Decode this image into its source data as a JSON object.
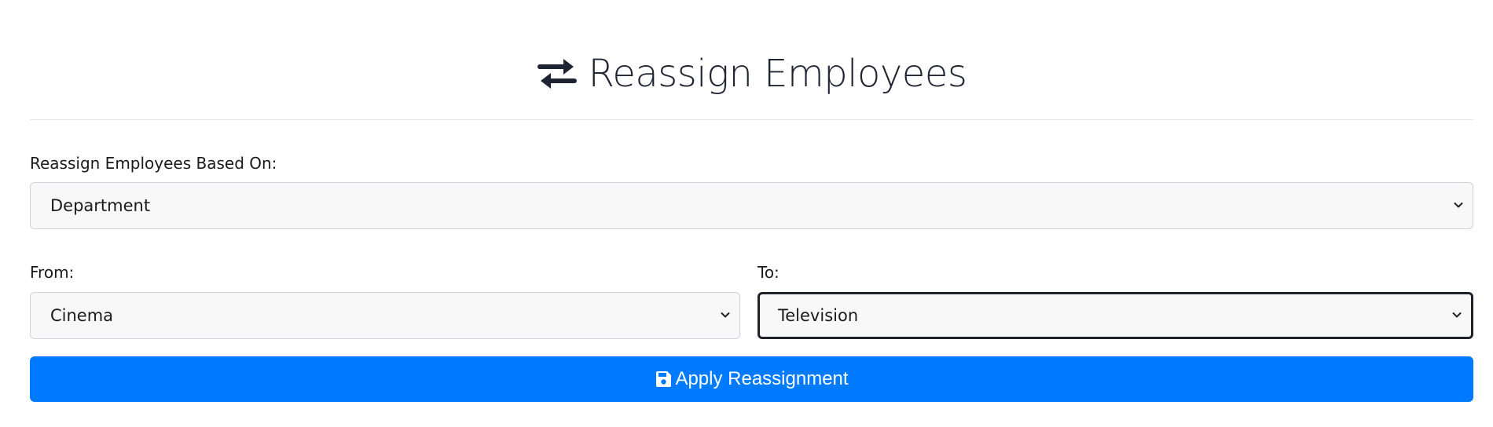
{
  "header": {
    "title": "Reassign Employees",
    "icon": "exchange-arrows-icon"
  },
  "basis": {
    "label": "Reassign Employees Based On:",
    "selected": "Department"
  },
  "from": {
    "label": "From:",
    "selected": "Cinema"
  },
  "to": {
    "label": "To:",
    "selected": "Television"
  },
  "apply_button": {
    "label": "Apply Reassignment",
    "icon": "floppy-disk-save-icon"
  },
  "colors": {
    "primary": "#007bff",
    "title": "#1f2433",
    "select_bg": "#f8f8f8",
    "focus_border": "#1f2229"
  }
}
